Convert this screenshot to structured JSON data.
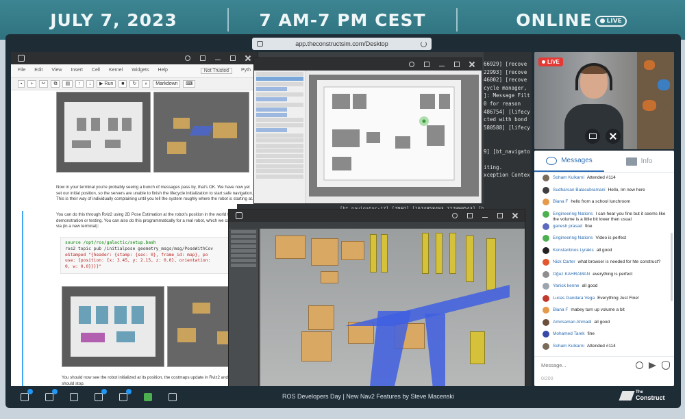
{
  "banner": {
    "date": "JULY 7, 2023",
    "time": "7 AM-7 PM CEST",
    "status": "ONLINE",
    "live_pill": "LIVE"
  },
  "browser": {
    "url": "app.theconstructsim.com/Desktop"
  },
  "jupyter": {
    "menus": [
      "File",
      "Edit",
      "View",
      "Insert",
      "Cell",
      "Kernel",
      "Widgets",
      "Help"
    ],
    "trust_label": "Not Trusted",
    "kernel_label": "Pyth",
    "run_label": "Run",
    "cell_type": "Markdown",
    "paragraph1": "Now in your terminal you're probably seeing a bunch of messages pass by, that's OK. We have now yet set our initial position, so the servers are unable to finish the lifecycle initialization to start safe navigation. This is their way of individually complaining until you tell the system roughly where the robot is starting at.",
    "paragraph2": "You can do this through Rviz2 using 2D Pose Estimation at the robot's position in the world for a demonstration or testing. You can also do this programmatically for a real robot, which we can mock up via (in a new terminal):",
    "code": [
      "source /opt/ros/galactic/setup.bash",
      "ros2 topic pub /initialpose geometry_msgs/msg/PoseWithCov",
      "eStamped \"{header: {stamp: {sec: 0}, frame_id: map}, po",
      "use: {position: {x: 3.45, y: 2.15, z: 0.0}, orientation:",
      "0, w: 0.0}}}}\""
    ],
    "paragraph3": "You should now see the robot initialized at its position, the costmaps update in Rviz2 and the warnings should stop."
  },
  "terminal": {
    "lines": [
      "66929] [recove",
      "22993] [recove",
      "46002] [recove",
      "cycle manager,",
      "]: Message Filt",
      "0 for reason",
      "",
      "486754] [lifecy",
      "cted with bond",
      "580588] [lifecy",
      "",
      "",
      "9] [bt_navigato",
      "",
      "iting.",
      "xception Contex"
    ],
    "bottom_line": "[bt_navigator-17] [INFO] [1674958493.222990543] [bt_navigat"
  },
  "taskbar": {
    "title": "ROS Developers Day | New Nav2 Features by Steve Macenski",
    "brand_top": "The",
    "brand_bottom": "Construct"
  },
  "webcam": {
    "live_label": "LIVE"
  },
  "chat": {
    "tab_messages": "Messages",
    "tab_info": "Info",
    "placeholder": "Message...",
    "counter": "0/200",
    "messages": [
      {
        "name": "Soham Kulkarni",
        "text": "Attended #114",
        "color": "#7a6a5a"
      },
      {
        "name": "Sudharsan Balasubramani",
        "text": "Hello, Im new here",
        "color": "#3e3e3e"
      },
      {
        "name": "Biana F",
        "text": "hello from a school lunchroom",
        "color": "#e59a4a"
      },
      {
        "name": "Engineering Nations",
        "text": "I can hear you fine but it seems like the volume is a little bit lower then usual",
        "color": "#4caf50"
      },
      {
        "name": "ganesh prasad",
        "text": "fine",
        "color": "#5c6bc0"
      },
      {
        "name": "Engineering Nations",
        "text": "Video is perfect",
        "color": "#4caf50"
      },
      {
        "name": "Konstantinos Lyrakis",
        "text": "all good",
        "color": "#222222"
      },
      {
        "name": "Nick Carter",
        "text": "what browser is needed for hte construct?",
        "color": "#e4572e"
      },
      {
        "name": "Oğuz KAHRAMAN",
        "text": "everything is perfect",
        "color": "#8e8e8e"
      },
      {
        "name": "Yanick kenne",
        "text": "all good",
        "color": "#9aa5ad"
      },
      {
        "name": "Lucas Gandara Vega",
        "text": "Everything Just Fine!",
        "color": "#c0392b"
      },
      {
        "name": "Biana F",
        "text": "mabey turn up volume a bit",
        "color": "#e59a4a"
      },
      {
        "name": "Amirsaman Ahmadi",
        "text": "all good",
        "color": "#6b4f3a"
      },
      {
        "name": "Mohamed Tarek",
        "text": "fine",
        "color": "#3949ab"
      },
      {
        "name": "Soham Kulkarni",
        "text": "Attended #114",
        "color": "#7a6a5a"
      },
      {
        "name": "Sudharsan Balasubramani",
        "text": "Hello, Im new here",
        "color": "#3e3e3e"
      }
    ]
  }
}
